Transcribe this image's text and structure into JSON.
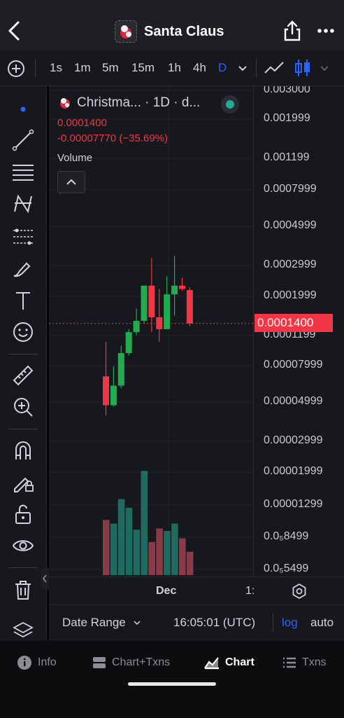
{
  "header": {
    "title": "Santa Claus"
  },
  "toolbar": {
    "intervals": [
      "1s",
      "1m",
      "5m",
      "15m",
      "1h",
      "4h",
      "D"
    ],
    "active_interval": "D"
  },
  "legend": {
    "symbol": "Christma... · 1D · d...",
    "price": "0.0001400",
    "change": "-0.00007770 (−35.69%)",
    "volume_label": "Volume"
  },
  "price_scale": {
    "ticks": [
      "0.003000",
      "0.001999",
      "0.001199",
      "0.0007999",
      "0.0004999",
      "0.0002999",
      "0.0001999",
      "0.0001199",
      "0.00007999",
      "0.00004999",
      "0.00002999",
      "0.00001999",
      "0.00001299",
      "0.0₅8499",
      "0.0₅5499"
    ],
    "current_price": "0.0001400"
  },
  "time_axis": {
    "labels": [
      "Dec",
      "1:"
    ]
  },
  "bottom_bar": {
    "date_range": "Date Range",
    "clock": "16:05:01 (UTC)",
    "log": "log",
    "auto": "auto"
  },
  "tabs": [
    {
      "label": "Info",
      "icon": "info-icon"
    },
    {
      "label": "Chart+Txns",
      "icon": "split-view-icon"
    },
    {
      "label": "Chart",
      "icon": "chart-icon",
      "active": true
    },
    {
      "label": "Txns",
      "icon": "list-icon"
    }
  ],
  "colors": {
    "up": "#22ab4f",
    "down": "#f23645",
    "accent": "#2962ff",
    "vol_up": "#1f6b5f",
    "vol_down": "#8a3a48"
  },
  "chart_data": {
    "type": "candlestick",
    "scale": "log",
    "candles": [
      {
        "o": 7e-05,
        "h": 0.00011,
        "l": 4.2e-05,
        "c": 4.8e-05
      },
      {
        "o": 4.8e-05,
        "h": 8e-05,
        "l": 4.7e-05,
        "c": 6.2e-05
      },
      {
        "o": 6.2e-05,
        "h": 0.000105,
        "l": 6e-05,
        "c": 9.5e-05
      },
      {
        "o": 9.5e-05,
        "h": 0.00013,
        "l": 9.2e-05,
        "c": 0.000125
      },
      {
        "o": 0.000125,
        "h": 0.00017,
        "l": 0.00012,
        "c": 0.000145
      },
      {
        "o": 0.000145,
        "h": 0.000215,
        "l": 0.00014,
        "c": 0.00023
      },
      {
        "o": 0.00023,
        "h": 0.00033,
        "l": 0.000125,
        "c": 0.000152
      },
      {
        "o": 0.000152,
        "h": 0.00022,
        "l": 0.00011,
        "c": 0.00013
      },
      {
        "o": 0.00013,
        "h": 0.00026,
        "l": 0.000145,
        "c": 0.000205
      },
      {
        "o": 0.000205,
        "h": 0.00034,
        "l": 0.000155,
        "c": 0.00023
      },
      {
        "o": 0.00023,
        "h": 0.000255,
        "l": 0.000215,
        "c": 0.00022
      },
      {
        "o": 0.000217,
        "h": 0.000225,
        "l": 0.000135,
        "c": 0.00014
      }
    ],
    "volume": [
      0.45,
      0.42,
      0.62,
      0.55,
      0.37,
      0.85,
      0.27,
      0.38,
      0.36,
      0.42,
      0.3,
      0.19
    ]
  }
}
